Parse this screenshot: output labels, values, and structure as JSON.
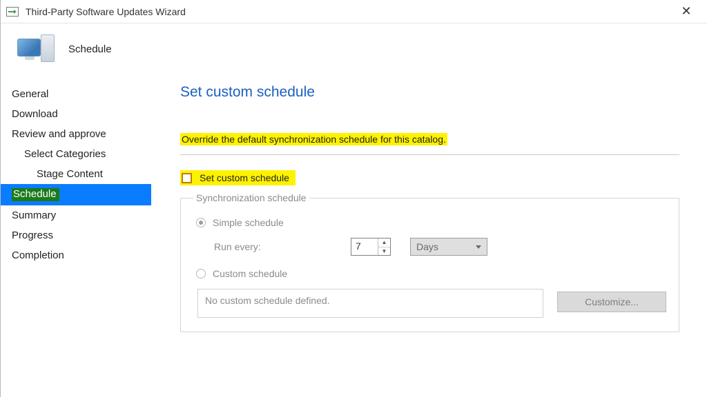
{
  "window": {
    "title": "Third-Party Software Updates Wizard",
    "close_glyph": "✕"
  },
  "header": {
    "step_title": "Schedule"
  },
  "nav": {
    "items": [
      {
        "label": "General",
        "indent": 0,
        "selected": false
      },
      {
        "label": "Download",
        "indent": 0,
        "selected": false
      },
      {
        "label": "Review and approve",
        "indent": 0,
        "selected": false
      },
      {
        "label": "Select Categories",
        "indent": 1,
        "selected": false
      },
      {
        "label": "Stage Content",
        "indent": 2,
        "selected": false
      },
      {
        "label": "Schedule",
        "indent": 0,
        "selected": true
      },
      {
        "label": "Summary",
        "indent": 0,
        "selected": false
      },
      {
        "label": "Progress",
        "indent": 0,
        "selected": false
      },
      {
        "label": "Completion",
        "indent": 0,
        "selected": false
      }
    ]
  },
  "page": {
    "title": "Set custom schedule",
    "description": "Override the default synchronization schedule for this catalog.",
    "checkbox_label": "Set custom schedule",
    "checkbox_checked": false,
    "fieldset_legend": "Synchronization schedule",
    "radio_simple_label": "Simple schedule",
    "radio_custom_label": "Custom schedule",
    "selected_radio": "simple",
    "run_every_label": "Run every:",
    "run_every_value": "7",
    "run_every_unit": "Days",
    "custom_schedule_text": "No custom schedule defined.",
    "customize_button": "Customize..."
  }
}
